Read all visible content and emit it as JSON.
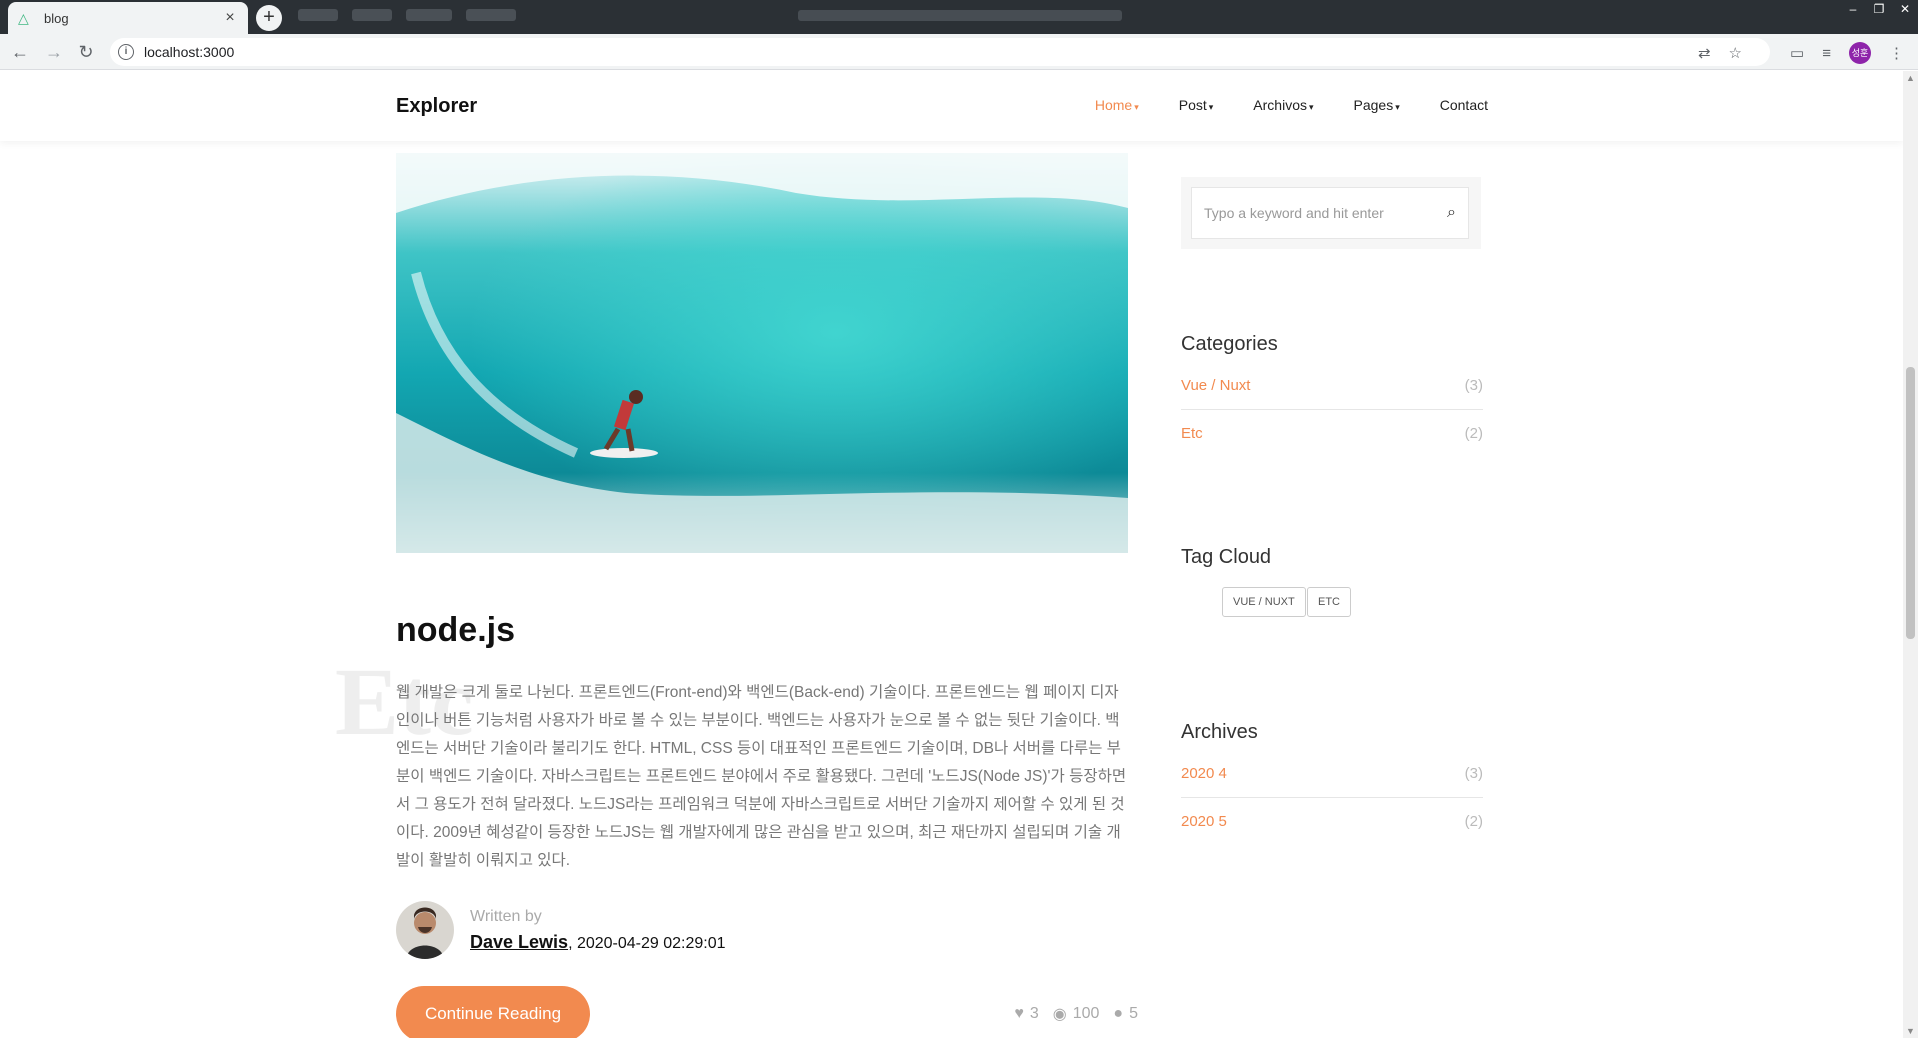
{
  "browser": {
    "tab_title": "blog",
    "tab_close": "×",
    "new_tab": "+",
    "url": "localhost:3000",
    "back": "←",
    "forward": "→",
    "reload": "↻",
    "info": "i",
    "translate": "⇄",
    "star": "☆",
    "cast": "▭",
    "queue": "≡",
    "profile_initials": "성훈",
    "menu": "⋮",
    "win_min": "–",
    "win_restore": "❐",
    "win_close": "✕"
  },
  "nav": {
    "brand": "Explorer",
    "items": [
      {
        "label": "Home",
        "active": true
      },
      {
        "label": "Post",
        "active": false
      },
      {
        "label": "Archivos",
        "active": false
      },
      {
        "label": "Pages",
        "active": false
      },
      {
        "label": "Contact",
        "active": false
      }
    ],
    "caret": "▾"
  },
  "post": {
    "category_watermark": "Etc",
    "title": "node.js",
    "excerpt": "웹 개발은 크게 둘로 나뉜다. 프론트엔드(Front-end)와 백엔드(Back-end) 기술이다. 프론트엔드는 웹 페이지 디자인이나 버튼 기능처럼 사용자가 바로 볼 수 있는 부분이다. 백엔드는 사용자가 눈으로 볼 수 없는 뒷단 기술이다. 백엔드는 서버단 기술이라 불리기도 한다. HTML, CSS 등이 대표적인 프론트엔드 기술이며, DB나 서버를 다루는 부분이 백엔드 기술이다. 자바스크립트는 프론트엔드 분야에서 주로 활용됐다. 그런데 '노드JS(Node JS)'가 등장하면서 그 용도가 전혀 달라졌다. 노드JS라는 프레임워크 덕분에 자바스크립트로 서버단 기술까지 제어할 수 있게 된 것이다. 2009년 혜성같이 등장한 노드JS는 웹 개발자에게 많은 관심을 받고 있으며, 최근 재단까지 설립되며 기술 개발이 활발히 이뤄지고 있다.",
    "written_by": "Written by",
    "author": "Dave Lewis",
    "date": ", 2020-04-29 02:29:01",
    "continue_label": "Continue Reading",
    "likes": "3",
    "views": "100",
    "comments": "5",
    "heart_icon": "♥",
    "eye_icon": "◉",
    "comment_icon": "●"
  },
  "sidebar": {
    "search_placeholder": "Typo a keyword and hit enter",
    "search_icon": "⌕",
    "categories_heading": "Categories",
    "categories": [
      {
        "label": "Vue / Nuxt",
        "count": "(3)"
      },
      {
        "label": "Etc",
        "count": "(2)"
      }
    ],
    "tagcloud_heading": "Tag Cloud",
    "tags": [
      "VUE / NUXT",
      "ETC"
    ],
    "archives_heading": "Archives",
    "archives": [
      {
        "label": "2020 4",
        "count": "(3)"
      },
      {
        "label": "2020 5",
        "count": "(2)"
      }
    ]
  },
  "colors": {
    "accent": "#f28a4f",
    "chrome_dark": "#2b3035"
  }
}
